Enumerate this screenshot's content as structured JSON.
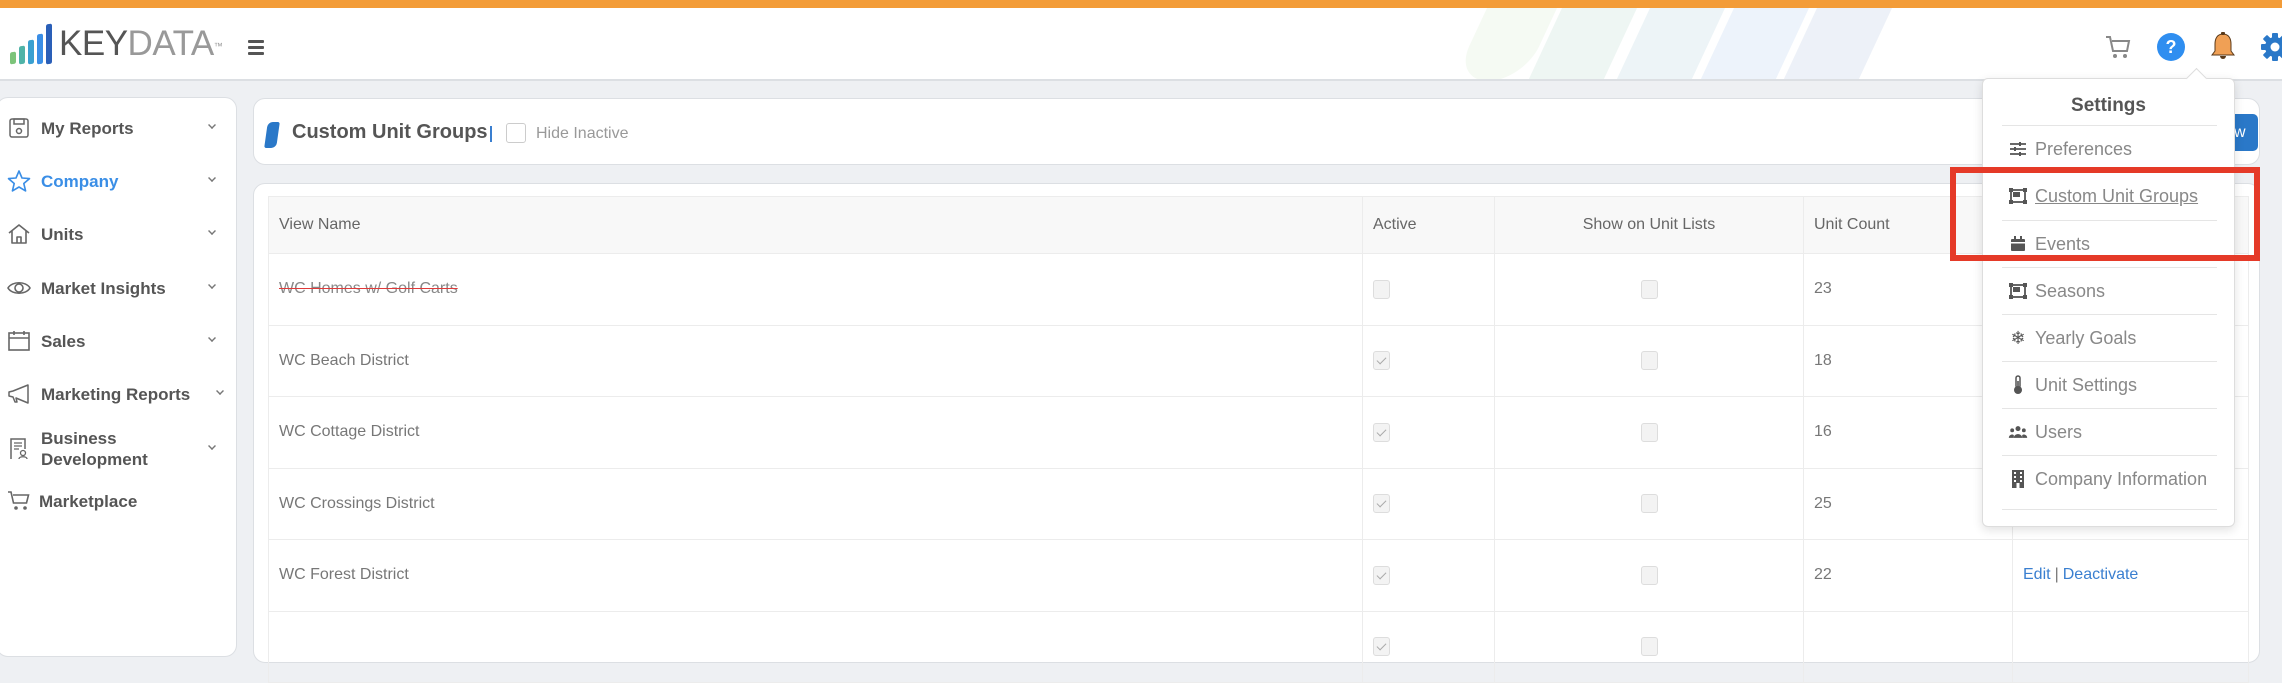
{
  "app": {
    "brand_key": "KEY",
    "brand_data": "DATA",
    "brand_tm": "™",
    "brand_color_accent": "#f39c38"
  },
  "header": {
    "icons": [
      {
        "name": "cart-icon",
        "color": "#888888"
      },
      {
        "name": "help-icon",
        "color": "#2f8ef0"
      },
      {
        "name": "bell-icon",
        "color": "#f0a055"
      },
      {
        "name": "gear-icon",
        "color": "#2a78c8"
      },
      {
        "name": "user-icon",
        "color": "#2a78c8"
      }
    ]
  },
  "sidebar": {
    "items": [
      {
        "label": "My Reports",
        "icon": "save-report-icon",
        "active": false
      },
      {
        "label": "Company",
        "icon": "star-icon",
        "active": true
      },
      {
        "label": "Units",
        "icon": "home-icon",
        "active": false
      },
      {
        "label": "Market Insights",
        "icon": "eye-icon",
        "active": false
      },
      {
        "label": "Sales",
        "icon": "calendar-icon",
        "active": false
      },
      {
        "label": "Marketing Reports",
        "icon": "megaphone-icon",
        "active": false
      },
      {
        "label": "Business Development",
        "icon": "document-person-icon",
        "active": false
      },
      {
        "label": "Marketplace",
        "icon": "cart-icon",
        "active": false
      }
    ]
  },
  "page": {
    "title": "Custom Unit Groups",
    "hide_inactive_label": "Hide Inactive",
    "hide_inactive_checked": false,
    "new_button_visible_text": "w"
  },
  "table": {
    "columns": [
      "View Name",
      "Active",
      "Show on Unit Lists",
      "Unit Count",
      ""
    ],
    "rows": [
      {
        "name": "WC Homes w/ Golf Carts",
        "inactive": true,
        "active": false,
        "show_on_lists": false,
        "unit_count": "23",
        "actions": []
      },
      {
        "name": "WC Beach District",
        "inactive": false,
        "active": true,
        "show_on_lists": false,
        "unit_count": "18",
        "actions": []
      },
      {
        "name": "WC Cottage District",
        "inactive": false,
        "active": true,
        "show_on_lists": false,
        "unit_count": "16",
        "actions": []
      },
      {
        "name": "WC Crossings District",
        "inactive": false,
        "active": true,
        "show_on_lists": false,
        "unit_count": "25",
        "actions": []
      },
      {
        "name": "WC Forest District",
        "inactive": false,
        "active": true,
        "show_on_lists": false,
        "unit_count": "22",
        "actions": [
          "Edit",
          "Deactivate"
        ]
      }
    ],
    "action_separator": "|"
  },
  "settings_menu": {
    "title": "Settings",
    "items": [
      {
        "label": "Preferences",
        "icon": "sliders-icon"
      },
      {
        "label": "Custom Unit Groups",
        "icon": "object-group-icon",
        "hovered": true
      },
      {
        "label": "Events",
        "icon": "calendar-icon"
      },
      {
        "label": "Seasons",
        "icon": "object-group-icon"
      },
      {
        "label": "Yearly Goals",
        "icon": "snowflake-icon"
      },
      {
        "label": "Unit Settings",
        "icon": "thermometer-icon"
      },
      {
        "label": "Users",
        "icon": "users-icon"
      },
      {
        "label": "Company Information",
        "icon": "building-icon"
      }
    ]
  },
  "annotation": {
    "highlight_color": "#e53a28",
    "highlighted_item": "Custom Unit Groups"
  }
}
